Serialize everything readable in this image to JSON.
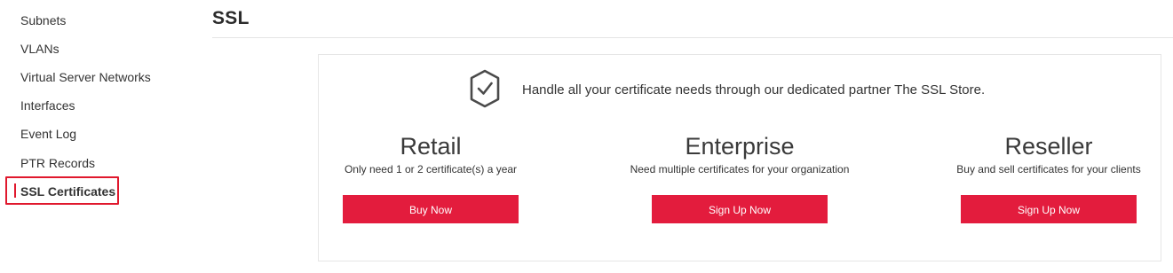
{
  "sidebar": {
    "items": [
      {
        "label": "Subnets"
      },
      {
        "label": "VLANs"
      },
      {
        "label": "Virtual Server Networks"
      },
      {
        "label": "Interfaces"
      },
      {
        "label": "Event Log"
      },
      {
        "label": "PTR Records"
      },
      {
        "label": "SSL Certificates",
        "active": true
      }
    ]
  },
  "page": {
    "title": "SSL"
  },
  "partner": {
    "icon": "shield-check-icon",
    "tagline": "Handle all your certificate needs through our dedicated partner The SSL Store."
  },
  "plans": [
    {
      "name": "Retail",
      "description": "Only need 1 or 2 certificate(s) a year",
      "button": "Buy Now"
    },
    {
      "name": "Enterprise",
      "description": "Need multiple certificates for your organization",
      "button": "Sign Up Now"
    },
    {
      "name": "Reseller",
      "description": "Buy and sell certificates for your clients",
      "button": "Sign Up Now"
    }
  ],
  "colors": {
    "accent": "#e31c3d",
    "highlight_box": "#e0182d"
  }
}
